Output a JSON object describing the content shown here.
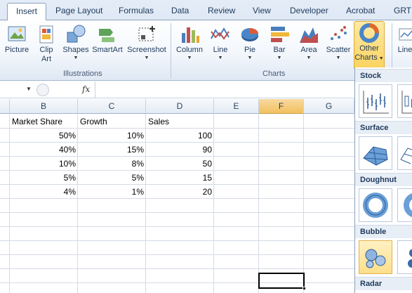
{
  "tabs": [
    {
      "label": "Insert",
      "active": true
    },
    {
      "label": "Page Layout"
    },
    {
      "label": "Formulas"
    },
    {
      "label": "Data"
    },
    {
      "label": "Review"
    },
    {
      "label": "View"
    },
    {
      "label": "Developer"
    },
    {
      "label": "Acrobat"
    },
    {
      "label": "GRT T"
    }
  ],
  "ribbon": {
    "illustrations": {
      "label": "Illustrations",
      "buttons": [
        {
          "line1": "Picture",
          "line2": ""
        },
        {
          "line1": "Clip",
          "line2": "Art"
        },
        {
          "line1": "Shapes",
          "line2": ""
        },
        {
          "line1": "SmartArt",
          "line2": ""
        },
        {
          "line1": "Screenshot",
          "line2": ""
        }
      ]
    },
    "charts": {
      "label": "Charts",
      "buttons": [
        {
          "line1": "Column",
          "line2": ""
        },
        {
          "line1": "Line",
          "line2": ""
        },
        {
          "line1": "Pie",
          "line2": ""
        },
        {
          "line1": "Bar",
          "line2": ""
        },
        {
          "line1": "Area",
          "line2": ""
        },
        {
          "line1": "Scatter",
          "line2": ""
        },
        {
          "line1": "Other",
          "line2": "Charts"
        }
      ]
    },
    "partial_button": "Line"
  },
  "formula_bar": {
    "fx": "fx"
  },
  "columns": [
    {
      "label": "B"
    },
    {
      "label": "C"
    },
    {
      "label": "D"
    },
    {
      "label": "E"
    },
    {
      "label": "F",
      "active": true
    },
    {
      "label": "G"
    }
  ],
  "table": {
    "headers": [
      "Market Share",
      "Growth",
      "Sales"
    ],
    "rows": [
      [
        "50%",
        "10%",
        "100"
      ],
      [
        "40%",
        "15%",
        "90"
      ],
      [
        "10%",
        "8%",
        "50"
      ],
      [
        "5%",
        "5%",
        "15"
      ],
      [
        "4%",
        "1%",
        "20"
      ]
    ]
  },
  "gallery": {
    "sections": [
      "Stock",
      "Surface",
      "Doughnut",
      "Bubble",
      "Radar"
    ]
  },
  "colors": {
    "accent_selected": "#fbd35e",
    "header_active": "#f1c15f",
    "ribbon_text": "#1e395b"
  }
}
